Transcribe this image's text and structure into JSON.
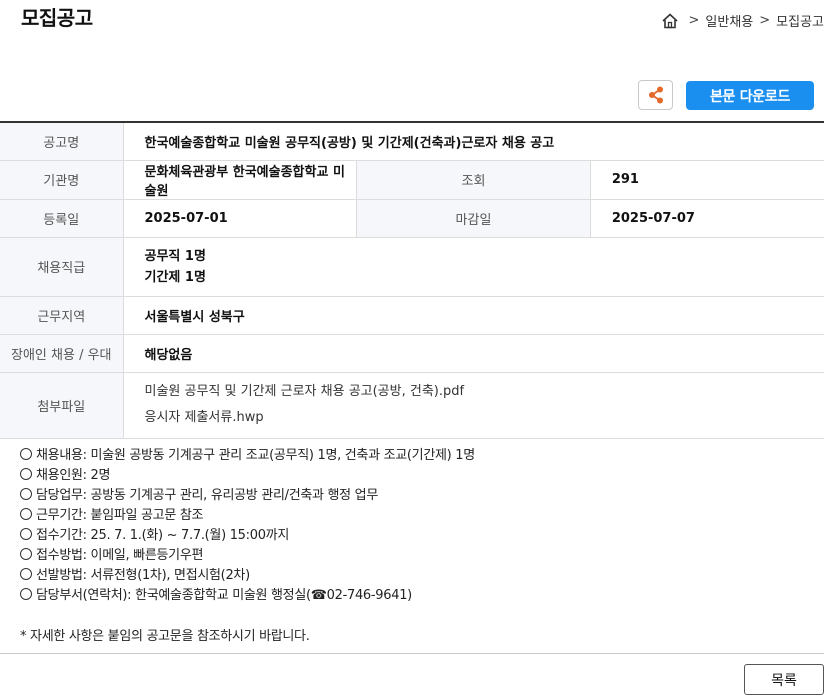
{
  "header": {
    "title": "모집공고",
    "breadcrumb": [
      "일반채용",
      "모집공고"
    ],
    "separator": ">"
  },
  "toolbar": {
    "share_icon": "share-icon",
    "download_label": "본문 다운로드"
  },
  "info": {
    "notice_name_label": "공고명",
    "notice_name": "한국예술종합학교 미술원 공무직(공방) 및 기간제(건축과)근로자 채용 공고",
    "agency_label": "기관명",
    "agency": "문화체육관광부 한국예술종합학교 미술원",
    "views_label": "조회",
    "views": "291",
    "registered_label": "등록일",
    "registered": "2025-07-01",
    "deadline_label": "마감일",
    "deadline": "2025-07-07",
    "position_label": "채용직급",
    "positions": [
      "공무직 1명",
      "기간제 1명"
    ],
    "location_label": "근무지역",
    "location": "서울특별시 성북구",
    "disabled_label": "장애인 채용 / 우대",
    "disabled": "해당없음",
    "attachments_label": "첨부파일",
    "attachments": [
      "미술원 공무직 및 기간제 근로자 채용 공고(공방, 건축).pdf",
      "응시자 제출서류.hwp"
    ]
  },
  "content": {
    "lines": [
      "채용내용: 미술원 공방동 기계공구 관리 조교(공무직) 1명, 건축과 조교(기간제) 1명",
      "채용인원: 2명",
      "담당업무: 공방동 기계공구 관리, 유리공방 관리/건축과 행정 업무",
      "근무기간: 붙임파일 공고문 참조",
      "접수기간: 25. 7. 1.(화) ~ 7.7.(월) 15:00까지",
      "접수방법: 이메일, 빠른등기우편",
      "선발방법: 서류전형(1차), 면접시험(2차)",
      "담당부서(연락처): 한국예술종합학교 미술원 행정실(☎02-746-9641)"
    ],
    "note": "* 자세한 사항은 붙임의 공고문을 참조하시기 바랍니다."
  },
  "footer": {
    "list_label": "목록"
  }
}
